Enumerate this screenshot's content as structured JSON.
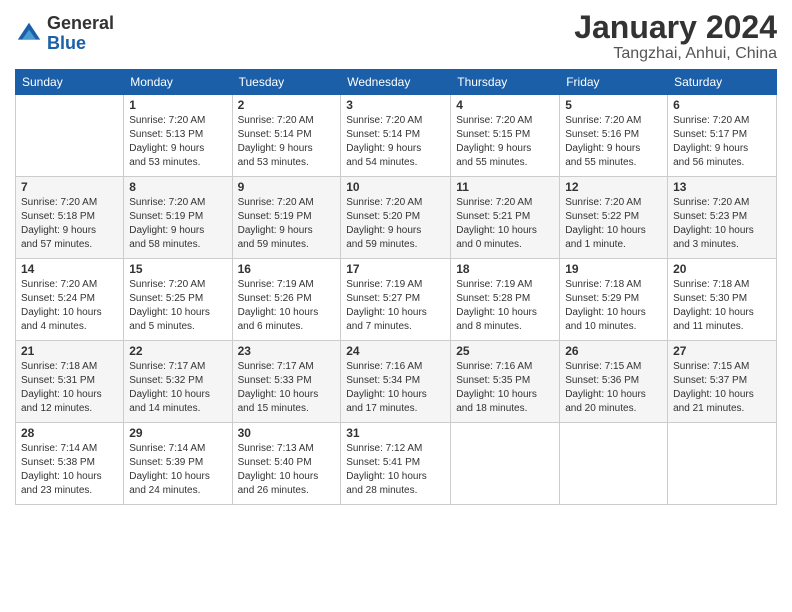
{
  "header": {
    "logo_general": "General",
    "logo_blue": "Blue",
    "month_title": "January 2024",
    "location": "Tangzhai, Anhui, China"
  },
  "calendar": {
    "days_of_week": [
      "Sunday",
      "Monday",
      "Tuesday",
      "Wednesday",
      "Thursday",
      "Friday",
      "Saturday"
    ],
    "weeks": [
      [
        {
          "day": "",
          "info": ""
        },
        {
          "day": "1",
          "info": "Sunrise: 7:20 AM\nSunset: 5:13 PM\nDaylight: 9 hours\nand 53 minutes."
        },
        {
          "day": "2",
          "info": "Sunrise: 7:20 AM\nSunset: 5:14 PM\nDaylight: 9 hours\nand 53 minutes."
        },
        {
          "day": "3",
          "info": "Sunrise: 7:20 AM\nSunset: 5:14 PM\nDaylight: 9 hours\nand 54 minutes."
        },
        {
          "day": "4",
          "info": "Sunrise: 7:20 AM\nSunset: 5:15 PM\nDaylight: 9 hours\nand 55 minutes."
        },
        {
          "day": "5",
          "info": "Sunrise: 7:20 AM\nSunset: 5:16 PM\nDaylight: 9 hours\nand 55 minutes."
        },
        {
          "day": "6",
          "info": "Sunrise: 7:20 AM\nSunset: 5:17 PM\nDaylight: 9 hours\nand 56 minutes."
        }
      ],
      [
        {
          "day": "7",
          "info": "Sunrise: 7:20 AM\nSunset: 5:18 PM\nDaylight: 9 hours\nand 57 minutes."
        },
        {
          "day": "8",
          "info": "Sunrise: 7:20 AM\nSunset: 5:19 PM\nDaylight: 9 hours\nand 58 minutes."
        },
        {
          "day": "9",
          "info": "Sunrise: 7:20 AM\nSunset: 5:19 PM\nDaylight: 9 hours\nand 59 minutes."
        },
        {
          "day": "10",
          "info": "Sunrise: 7:20 AM\nSunset: 5:20 PM\nDaylight: 9 hours\nand 59 minutes."
        },
        {
          "day": "11",
          "info": "Sunrise: 7:20 AM\nSunset: 5:21 PM\nDaylight: 10 hours\nand 0 minutes."
        },
        {
          "day": "12",
          "info": "Sunrise: 7:20 AM\nSunset: 5:22 PM\nDaylight: 10 hours\nand 1 minute."
        },
        {
          "day": "13",
          "info": "Sunrise: 7:20 AM\nSunset: 5:23 PM\nDaylight: 10 hours\nand 3 minutes."
        }
      ],
      [
        {
          "day": "14",
          "info": "Sunrise: 7:20 AM\nSunset: 5:24 PM\nDaylight: 10 hours\nand 4 minutes."
        },
        {
          "day": "15",
          "info": "Sunrise: 7:20 AM\nSunset: 5:25 PM\nDaylight: 10 hours\nand 5 minutes."
        },
        {
          "day": "16",
          "info": "Sunrise: 7:19 AM\nSunset: 5:26 PM\nDaylight: 10 hours\nand 6 minutes."
        },
        {
          "day": "17",
          "info": "Sunrise: 7:19 AM\nSunset: 5:27 PM\nDaylight: 10 hours\nand 7 minutes."
        },
        {
          "day": "18",
          "info": "Sunrise: 7:19 AM\nSunset: 5:28 PM\nDaylight: 10 hours\nand 8 minutes."
        },
        {
          "day": "19",
          "info": "Sunrise: 7:18 AM\nSunset: 5:29 PM\nDaylight: 10 hours\nand 10 minutes."
        },
        {
          "day": "20",
          "info": "Sunrise: 7:18 AM\nSunset: 5:30 PM\nDaylight: 10 hours\nand 11 minutes."
        }
      ],
      [
        {
          "day": "21",
          "info": "Sunrise: 7:18 AM\nSunset: 5:31 PM\nDaylight: 10 hours\nand 12 minutes."
        },
        {
          "day": "22",
          "info": "Sunrise: 7:17 AM\nSunset: 5:32 PM\nDaylight: 10 hours\nand 14 minutes."
        },
        {
          "day": "23",
          "info": "Sunrise: 7:17 AM\nSunset: 5:33 PM\nDaylight: 10 hours\nand 15 minutes."
        },
        {
          "day": "24",
          "info": "Sunrise: 7:16 AM\nSunset: 5:34 PM\nDaylight: 10 hours\nand 17 minutes."
        },
        {
          "day": "25",
          "info": "Sunrise: 7:16 AM\nSunset: 5:35 PM\nDaylight: 10 hours\nand 18 minutes."
        },
        {
          "day": "26",
          "info": "Sunrise: 7:15 AM\nSunset: 5:36 PM\nDaylight: 10 hours\nand 20 minutes."
        },
        {
          "day": "27",
          "info": "Sunrise: 7:15 AM\nSunset: 5:37 PM\nDaylight: 10 hours\nand 21 minutes."
        }
      ],
      [
        {
          "day": "28",
          "info": "Sunrise: 7:14 AM\nSunset: 5:38 PM\nDaylight: 10 hours\nand 23 minutes."
        },
        {
          "day": "29",
          "info": "Sunrise: 7:14 AM\nSunset: 5:39 PM\nDaylight: 10 hours\nand 24 minutes."
        },
        {
          "day": "30",
          "info": "Sunrise: 7:13 AM\nSunset: 5:40 PM\nDaylight: 10 hours\nand 26 minutes."
        },
        {
          "day": "31",
          "info": "Sunrise: 7:12 AM\nSunset: 5:41 PM\nDaylight: 10 hours\nand 28 minutes."
        },
        {
          "day": "",
          "info": ""
        },
        {
          "day": "",
          "info": ""
        },
        {
          "day": "",
          "info": ""
        }
      ]
    ]
  }
}
